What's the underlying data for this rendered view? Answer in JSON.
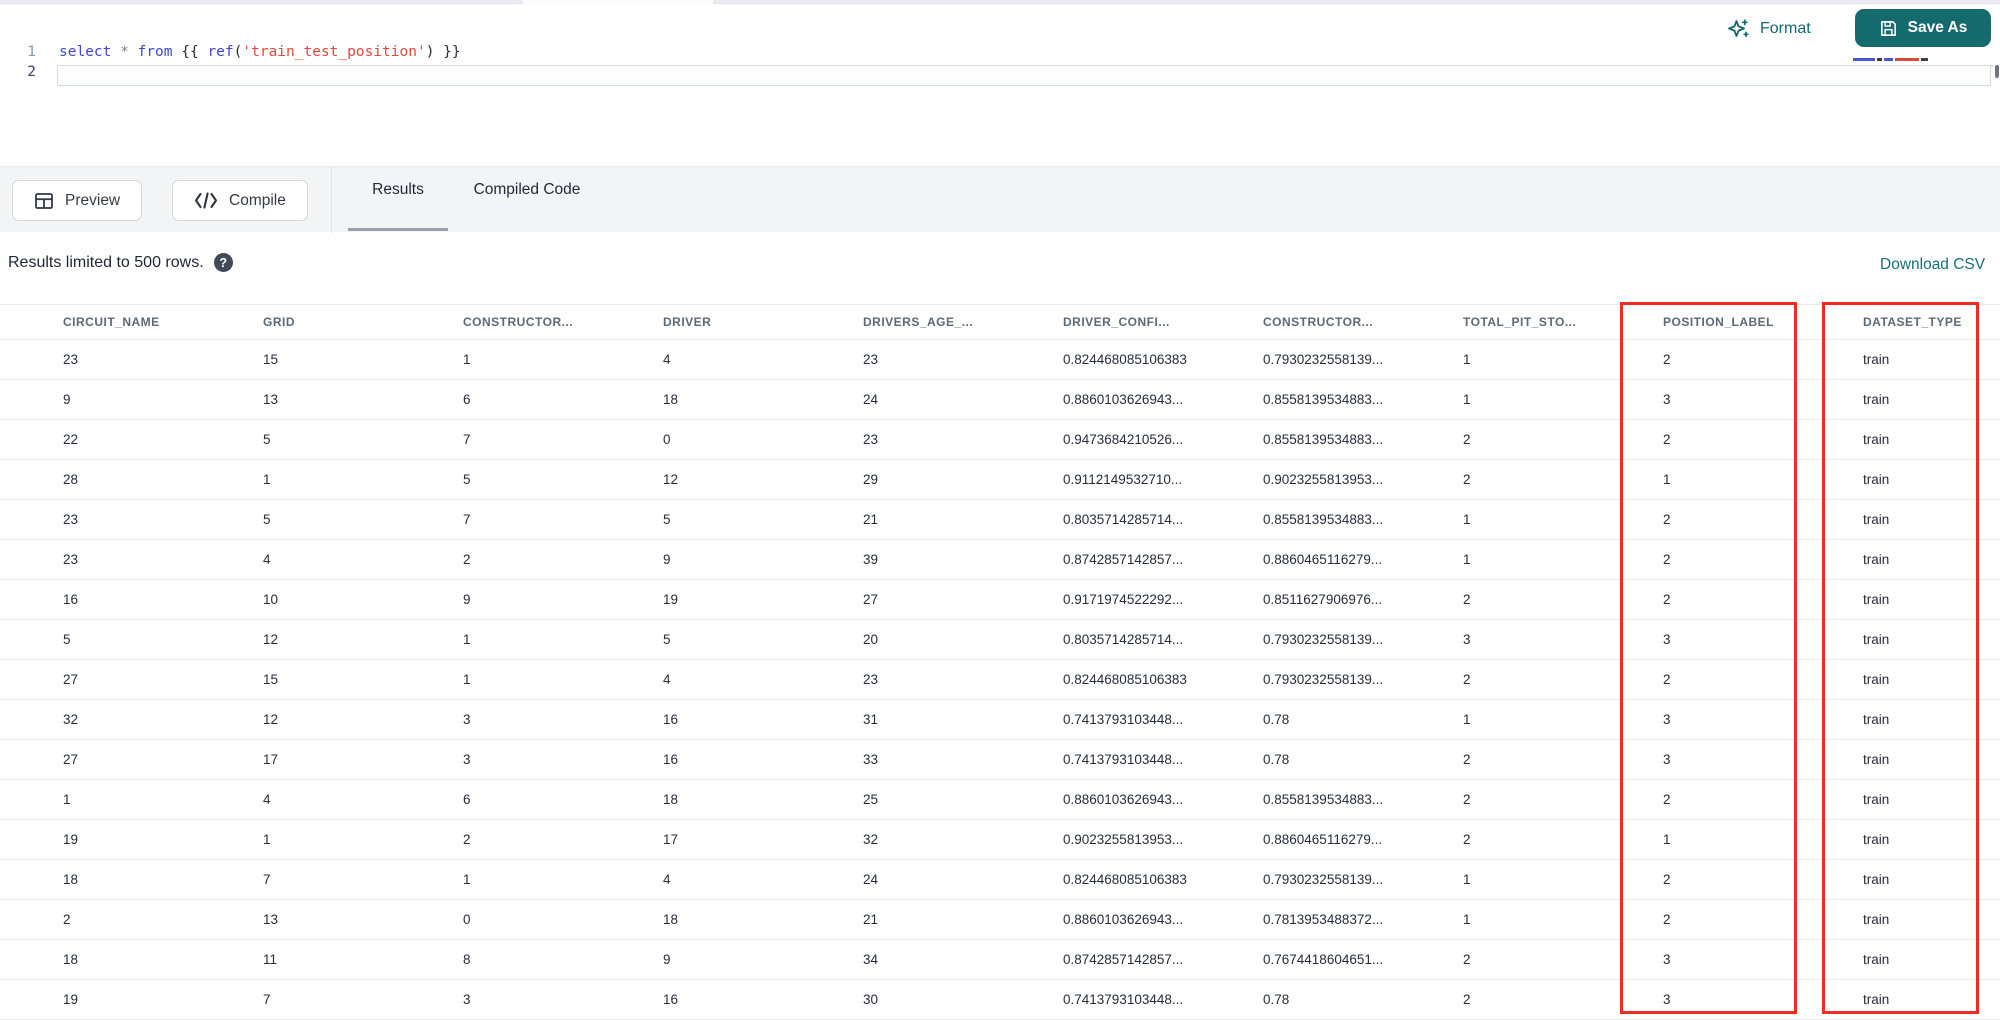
{
  "editor": {
    "toolbar": {
      "format_label": "Format",
      "save_as_label": "Save As"
    },
    "line_numbers": {
      "line1": "1",
      "line2": "2"
    },
    "code_tokens": [
      {
        "text": "select",
        "type": "keyword"
      },
      {
        "text": " ",
        "type": "plain"
      },
      {
        "text": "*",
        "type": "operator"
      },
      {
        "text": " ",
        "type": "plain"
      },
      {
        "text": "from",
        "type": "keyword"
      },
      {
        "text": " {{ ",
        "type": "plain"
      },
      {
        "text": "ref",
        "type": "keyword"
      },
      {
        "text": "(",
        "type": "plain"
      },
      {
        "text": "'train_test_position'",
        "type": "string"
      },
      {
        "text": ") }}",
        "type": "plain"
      }
    ]
  },
  "action_bar": {
    "preview_label": "Preview",
    "compile_label": "Compile",
    "tabs": [
      {
        "label": "Results",
        "active": true
      },
      {
        "label": "Compiled Code",
        "active": false
      }
    ]
  },
  "results": {
    "limit_note": "Results limited to 500 rows.",
    "help_icon_glyph": "?",
    "download_csv_label": "Download CSV"
  },
  "table": {
    "columns": [
      "CIRCUIT_NAME",
      "GRID",
      "CONSTRUCTOR...",
      "DRIVER",
      "DRIVERS_AGE_...",
      "DRIVER_CONFI...",
      "CONSTRUCTOR...",
      "TOTAL_PIT_STO...",
      "POSITION_LABEL",
      "DATASET_TYPE"
    ],
    "rows": [
      [
        "23",
        "15",
        "1",
        "4",
        "23",
        "0.824468085106383",
        "0.7930232558139...",
        "1",
        "2",
        "train"
      ],
      [
        "9",
        "13",
        "6",
        "18",
        "24",
        "0.8860103626943...",
        "0.8558139534883...",
        "1",
        "3",
        "train"
      ],
      [
        "22",
        "5",
        "7",
        "0",
        "23",
        "0.9473684210526...",
        "0.8558139534883...",
        "2",
        "2",
        "train"
      ],
      [
        "28",
        "1",
        "5",
        "12",
        "29",
        "0.9112149532710...",
        "0.9023255813953...",
        "2",
        "1",
        "train"
      ],
      [
        "23",
        "5",
        "7",
        "5",
        "21",
        "0.8035714285714...",
        "0.8558139534883...",
        "1",
        "2",
        "train"
      ],
      [
        "23",
        "4",
        "2",
        "9",
        "39",
        "0.8742857142857...",
        "0.8860465116279...",
        "1",
        "2",
        "train"
      ],
      [
        "16",
        "10",
        "9",
        "19",
        "27",
        "0.9171974522292...",
        "0.8511627906976...",
        "2",
        "2",
        "train"
      ],
      [
        "5",
        "12",
        "1",
        "5",
        "20",
        "0.8035714285714...",
        "0.7930232558139...",
        "3",
        "3",
        "train"
      ],
      [
        "27",
        "15",
        "1",
        "4",
        "23",
        "0.824468085106383",
        "0.7930232558139...",
        "2",
        "2",
        "train"
      ],
      [
        "32",
        "12",
        "3",
        "16",
        "31",
        "0.7413793103448...",
        "0.78",
        "1",
        "3",
        "train"
      ],
      [
        "27",
        "17",
        "3",
        "16",
        "33",
        "0.7413793103448...",
        "0.78",
        "2",
        "3",
        "train"
      ],
      [
        "1",
        "4",
        "6",
        "18",
        "25",
        "0.8860103626943...",
        "0.8558139534883...",
        "2",
        "2",
        "train"
      ],
      [
        "19",
        "1",
        "2",
        "17",
        "32",
        "0.9023255813953...",
        "0.8860465116279...",
        "2",
        "1",
        "train"
      ],
      [
        "18",
        "7",
        "1",
        "4",
        "24",
        "0.824468085106383",
        "0.7930232558139...",
        "1",
        "2",
        "train"
      ],
      [
        "2",
        "13",
        "0",
        "18",
        "21",
        "0.8860103626943...",
        "0.7813953488372...",
        "1",
        "2",
        "train"
      ],
      [
        "18",
        "11",
        "8",
        "9",
        "34",
        "0.8742857142857...",
        "0.7674418604651...",
        "2",
        "3",
        "train"
      ],
      [
        "19",
        "7",
        "3",
        "16",
        "30",
        "0.7413793103448...",
        "0.78",
        "2",
        "3",
        "train"
      ]
    ],
    "highlighted_columns": [
      "POSITION_LABEL",
      "DATASET_TYPE"
    ]
  },
  "colors": {
    "accent_teal": "#156a6e",
    "link_teal": "#16707b",
    "highlight_red": "#ef2b23",
    "keyword_blue": "#3d47d4",
    "string_red": "#e2483c"
  }
}
